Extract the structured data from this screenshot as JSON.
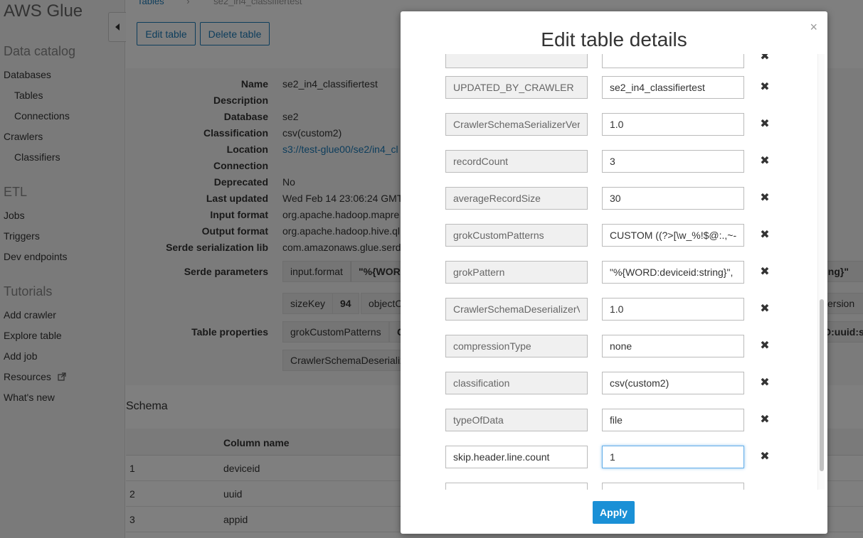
{
  "sidebar": {
    "brand": "AWS Glue",
    "sections": [
      {
        "title": "Data catalog",
        "items": [
          "Databases",
          "Tables",
          "Connections",
          "Crawlers",
          "Classifiers"
        ]
      },
      {
        "title": "ETL",
        "items": [
          "Jobs",
          "Triggers",
          "Dev endpoints"
        ]
      },
      {
        "title": "Tutorials",
        "items": [
          "Add crawler",
          "Explore table",
          "Add job",
          "Resources",
          "What's new"
        ]
      }
    ]
  },
  "breadcrumb": {
    "parent": "Tables",
    "current": "se2_in4_classifiertest"
  },
  "toolbar": {
    "edit_label": "Edit table",
    "delete_label": "Delete table"
  },
  "details": {
    "labels": {
      "name": "Name",
      "description": "Description",
      "database": "Database",
      "classification": "Classification",
      "location": "Location",
      "connection": "Connection",
      "deprecated": "Deprecated",
      "last_updated": "Last updated",
      "input_format": "Input format",
      "output_format": "Output format",
      "serde_lib": "Serde serialization lib",
      "serde_params": "Serde parameters",
      "table_props": "Table properties"
    },
    "values": {
      "name": "se2_in4_classifiertest",
      "database": "se2",
      "classification": "csv(custom2)",
      "location": "s3://test-glue00/se2/in4_cl",
      "deprecated": "No",
      "last_updated": "Wed Feb 14 23:06:24 GMT",
      "input_format": "org.apache.hadoop.mapre",
      "output_format": "org.apache.hadoop.hive.ql",
      "serde_lib": "com.amazonaws.glue.serd"
    },
    "serde_chips": {
      "input_format_key": "input.format",
      "input_format_val": "\"%{WOR",
      "size_key": "sizeKey",
      "size_val": "94",
      "object_key": "objectC",
      "right_clip_1": "string}\"",
      "right_clip_2": "ersion"
    },
    "table_prop_chips": {
      "grok": "grokCustomPatterns",
      "grok_val": "C",
      "crawler": "CrawlerSchemaDeserializ",
      "right_clip": "D:uuid:st"
    }
  },
  "schema": {
    "title": "Schema",
    "column_header": "Column name",
    "rows": [
      {
        "idx": "1",
        "name": "deviceid"
      },
      {
        "idx": "2",
        "name": "uuid"
      },
      {
        "idx": "3",
        "name": "appid"
      }
    ]
  },
  "modal": {
    "title": "Edit table details",
    "close": "×",
    "apply_label": "Apply",
    "properties": [
      {
        "key": "UPDATED_BY_CRAWLER",
        "value": "se2_in4_classifiertest"
      },
      {
        "key": "CrawlerSchemaSerializerVer:",
        "value": "1.0"
      },
      {
        "key": "recordCount",
        "value": "3"
      },
      {
        "key": "averageRecordSize",
        "value": "30"
      },
      {
        "key": "grokCustomPatterns",
        "value": "CUSTOM ((?>[\\w_%!$@:.,~-]"
      },
      {
        "key": "grokPattern",
        "value": "\"%{WORD:deviceid:string}\","
      },
      {
        "key": "CrawlerSchemaDeserializerV",
        "value": "1.0"
      },
      {
        "key": "compressionType",
        "value": "none"
      },
      {
        "key": "classification",
        "value": "csv(custom2)"
      },
      {
        "key": "typeOfData",
        "value": "file"
      },
      {
        "key": "skip.header.line.count",
        "value": "1"
      }
    ]
  }
}
